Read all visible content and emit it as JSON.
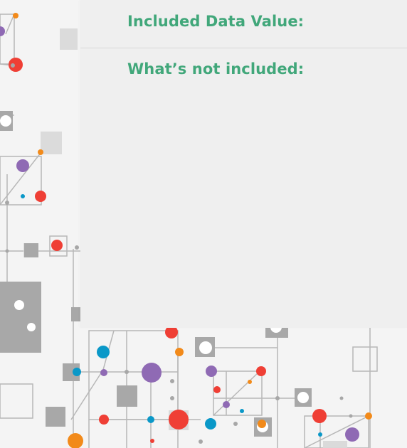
{
  "panel": {
    "included_label": "Included Data Value:",
    "not_included_label": "What’s not included:"
  },
  "colors": {
    "heading_green": "#41a77a",
    "purple": "#8f6ab4",
    "red": "#ef3f35",
    "blue": "#0a98c8",
    "orange": "#f28a1a",
    "gray": "#a8a8a8"
  },
  "background": {
    "icon": "network-cubes-icon"
  }
}
